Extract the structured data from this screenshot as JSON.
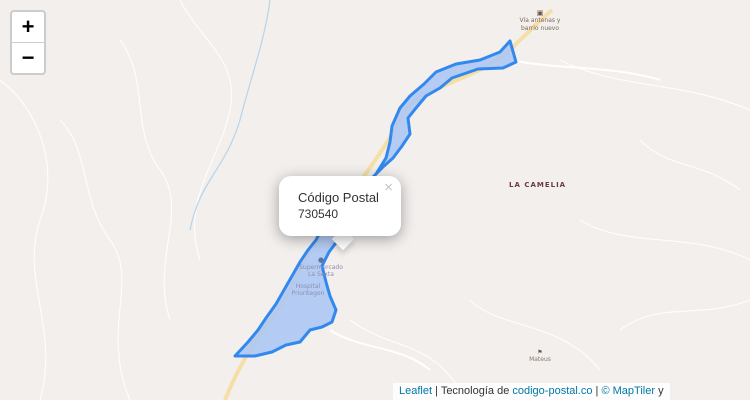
{
  "zoom": {
    "in_label": "+",
    "out_label": "−"
  },
  "popup": {
    "title": "Código Postal",
    "value": "730540",
    "close_label": "×"
  },
  "labels": {
    "la_camelia": "LA CAMELIA",
    "antenas_line1": "Vía antenas y",
    "antenas_line2": "barrio nuevo",
    "mateus": "Mateus",
    "supermercado_line1": "Supermercado",
    "supermercado_line2": "La Sexta",
    "hospital_line1": "Hospital",
    "hospital_line2": "Prioritegon"
  },
  "attribution": {
    "leaflet": "Leaflet",
    "separator": " | ",
    "tech_prefix": "Tecnología de ",
    "codigo_postal": "codigo-postal.co",
    "maptiler": "© MapTiler",
    "trailing": " y"
  },
  "colors": {
    "background": "#f2efed",
    "area_fill": "#a9c5f5",
    "area_stroke": "#3388ee",
    "road": "#f6dfa6",
    "contour": "#ffffff",
    "stream": "#b8d4e8"
  }
}
